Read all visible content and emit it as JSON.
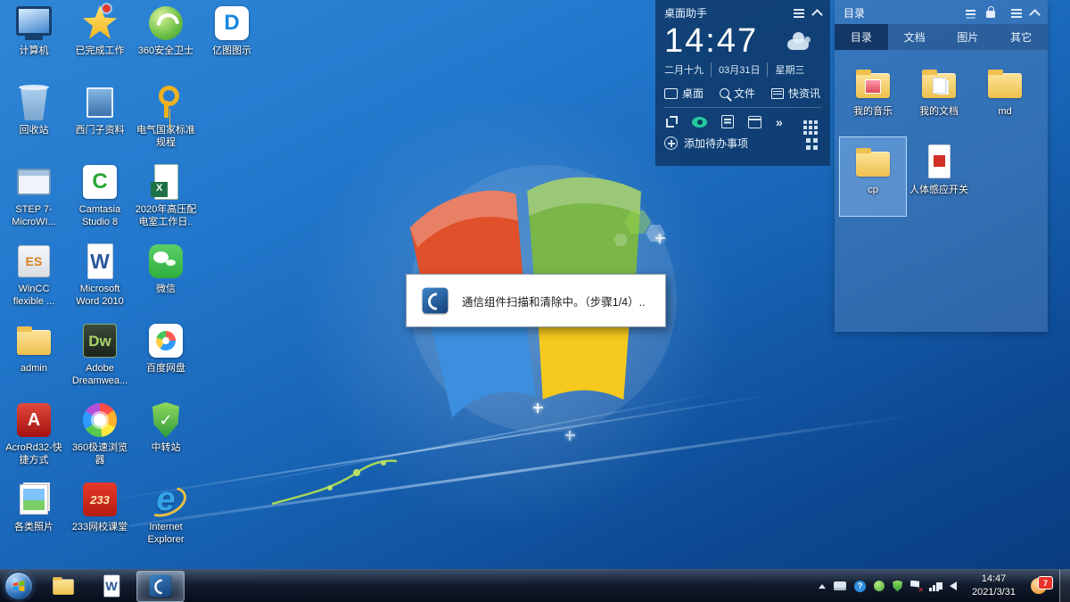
{
  "desktop": {
    "col1": [
      {
        "icon": "computer",
        "label": "计算机",
        "glyph": ""
      },
      {
        "icon": "recycle-bin",
        "label": "回收站",
        "glyph": ""
      },
      {
        "icon": "step7",
        "label": "STEP 7-MicroWI...",
        "glyph": ""
      },
      {
        "icon": "wincc",
        "label": "WinCC flexible ...",
        "glyph": "ES"
      },
      {
        "icon": "folder",
        "label": "admin",
        "glyph": ""
      },
      {
        "icon": "acrobat",
        "label": "AcroRd32-快捷方式",
        "glyph": "A"
      },
      {
        "icon": "photos",
        "label": "各类照片",
        "glyph": ""
      }
    ],
    "col2": [
      {
        "icon": "star",
        "label": "已完成工作",
        "glyph": ""
      },
      {
        "icon": "siemens-doc",
        "label": "西门子资料",
        "glyph": ""
      },
      {
        "icon": "camtasia",
        "label": "Camtasia Studio 8",
        "glyph": "C"
      },
      {
        "icon": "word",
        "label": "Microsoft Word 2010",
        "glyph": "W"
      },
      {
        "icon": "dreamweaver",
        "label": "Adobe Dreamwea...",
        "glyph": "Dw"
      },
      {
        "icon": "browser360",
        "label": "360极速浏览器",
        "glyph": ""
      },
      {
        "icon": "school233",
        "label": "233网校课堂",
        "glyph": "233"
      }
    ],
    "col3": [
      {
        "icon": "safe360",
        "label": "360安全卫士",
        "glyph": ""
      },
      {
        "icon": "key",
        "label": "电气国家标准规程",
        "glyph": ""
      },
      {
        "icon": "excel-doc",
        "label": "2020年高压配电室工作日..",
        "glyph": "X"
      },
      {
        "icon": "wechat",
        "label": "微信",
        "glyph": ""
      },
      {
        "icon": "baidu-pan",
        "label": "百度网盘",
        "glyph": ""
      },
      {
        "icon": "shield",
        "label": "中转站",
        "glyph": "✓"
      },
      {
        "icon": "ie",
        "label": "Internet Explorer",
        "glyph": "e"
      }
    ],
    "col4": [
      {
        "icon": "edraw",
        "label": "亿图图示",
        "glyph": "D"
      }
    ]
  },
  "dialog": {
    "message": "通信组件扫描和清除中。（步骤1/4）.."
  },
  "assistant": {
    "title": "桌面助手",
    "time": "14:47",
    "lunar_date": "二月十九",
    "date": "03月31日",
    "weekday": "星期三",
    "tabs": [
      {
        "icon": "monitor",
        "label": "桌面"
      },
      {
        "icon": "search",
        "label": "文件"
      },
      {
        "icon": "news",
        "label": "快资讯"
      }
    ],
    "todo_label": "添加待办事项"
  },
  "directory": {
    "title": "目录",
    "tabs": [
      {
        "label": "目录",
        "active": true
      },
      {
        "label": "文档"
      },
      {
        "label": "图片"
      },
      {
        "label": "其它"
      }
    ],
    "items": [
      {
        "icon": "folder-music",
        "label": "我的音乐"
      },
      {
        "icon": "folder-docs",
        "label": "我的文档"
      },
      {
        "icon": "folder",
        "label": "md"
      },
      {
        "icon": "folder",
        "label": "cp",
        "selected": true
      },
      {
        "icon": "doc-red",
        "label": "人体感应开关"
      }
    ]
  },
  "taskbar": {
    "pinned": [
      {
        "icon": "folder",
        "name": "explorer"
      },
      {
        "icon": "word",
        "name": "word",
        "glyph": "W"
      },
      {
        "icon": "scanner",
        "name": "scanner-app",
        "active": true
      }
    ],
    "time": "14:47",
    "date": "2021/3/31",
    "badge_count": "7",
    "help_glyph": "?"
  }
}
